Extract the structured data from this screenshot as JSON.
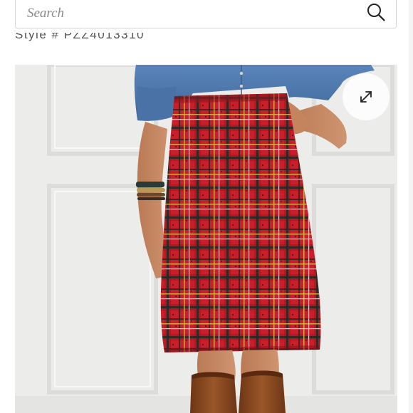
{
  "search": {
    "placeholder": "Search",
    "icon": "search-icon"
  },
  "product": {
    "style_number": "Style # PZZ4013310",
    "image_alt": "Model wearing a red tartan plaid pencil skirt with a chambray shirt and brown leather boots",
    "expand_icon": "expand-icon"
  },
  "colors": {
    "plaid_red": "#c8202a",
    "plaid_dark": "#1f2a26",
    "plaid_yellow": "#d9b24a",
    "denim": "#4f78ad",
    "boot_brown": "#8a4a22",
    "wall": "#ececeb"
  }
}
